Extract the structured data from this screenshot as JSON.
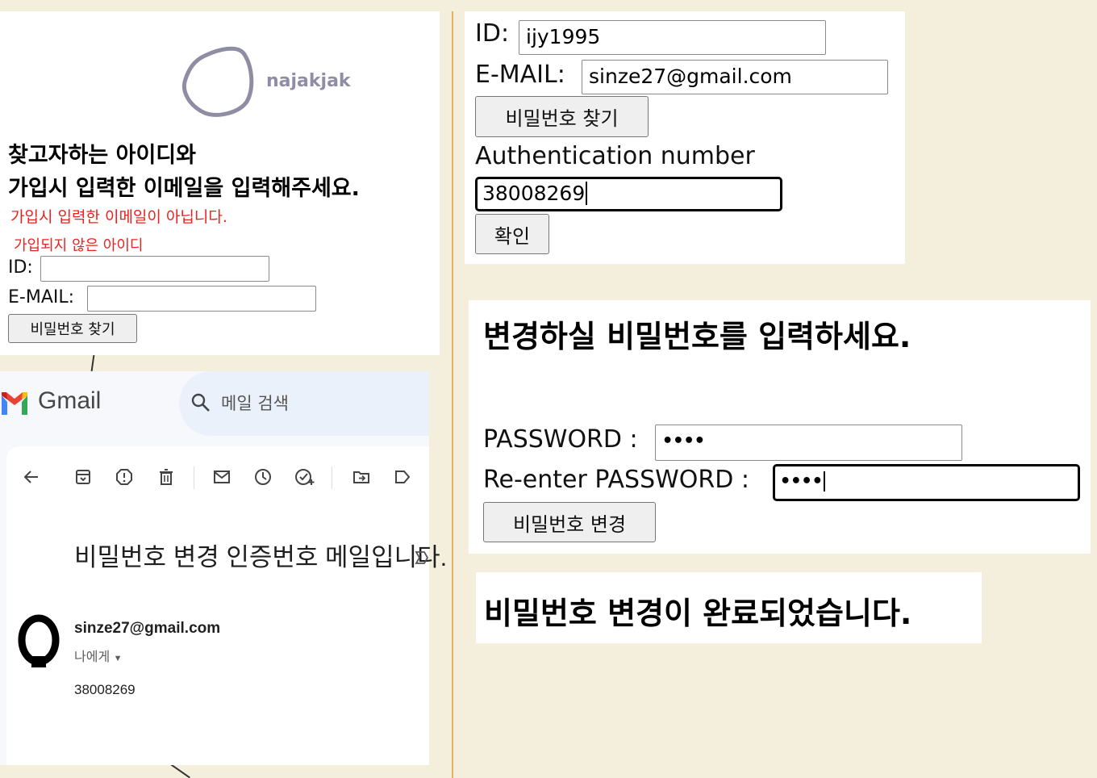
{
  "find_form": {
    "logo_text": "najakjak",
    "heading_line1": "찾고자하는 아이디와",
    "heading_line2": "가입시 입력한 이메일을 입력해주세요.",
    "error_email": "가입시 입력한 이메일이 아닙니다.",
    "error_id": "가입되지 않은 아이디",
    "id_label": "ID:",
    "id_value": "",
    "email_label": "E-MAIL:",
    "email_value": "",
    "submit_label": "비밀번호 찾기"
  },
  "gmail": {
    "logo_text": "Gmail",
    "search_placeholder": "메일 검색",
    "toolbar_icons": [
      "back-arrow-icon",
      "archive-icon",
      "report-spam-icon",
      "delete-icon",
      "mark-unread-icon",
      "snooze-icon",
      "add-task-icon",
      "move-to-icon",
      "label-icon"
    ],
    "subject": "비밀번호 변경 인증번호 메일입니다.",
    "sender": "sinze27@gmail.com",
    "recipient": "나에게",
    "body": "38008269"
  },
  "auth_form": {
    "id_label": "ID:",
    "id_value": "ijy1995",
    "email_label": "E-MAIL:",
    "email_value": "sinze27@gmail.com",
    "find_label": "비밀번호 찾기",
    "auth_label": "Authentication number",
    "auth_value": "38008269",
    "confirm_label": "확인"
  },
  "change_form": {
    "heading": "변경하실 비밀번호를 입력하세요.",
    "password_label": "PASSWORD :",
    "password_mask": "••••",
    "reenter_label": "Re-enter PASSWORD :",
    "reenter_mask": "••••",
    "submit_label": "비밀번호 변경"
  },
  "done": {
    "message": "비밀번호 변경이 완료되었습니다."
  },
  "colors": {
    "background": "#f3efdc",
    "divider": "#e3b25b",
    "error": "#e8231f",
    "logo": "#8f8da3",
    "gmail_red": "#ea4335",
    "gmail_blue": "#4285f4",
    "gmail_green": "#34a853",
    "gmail_yellow": "#fbbc04"
  }
}
